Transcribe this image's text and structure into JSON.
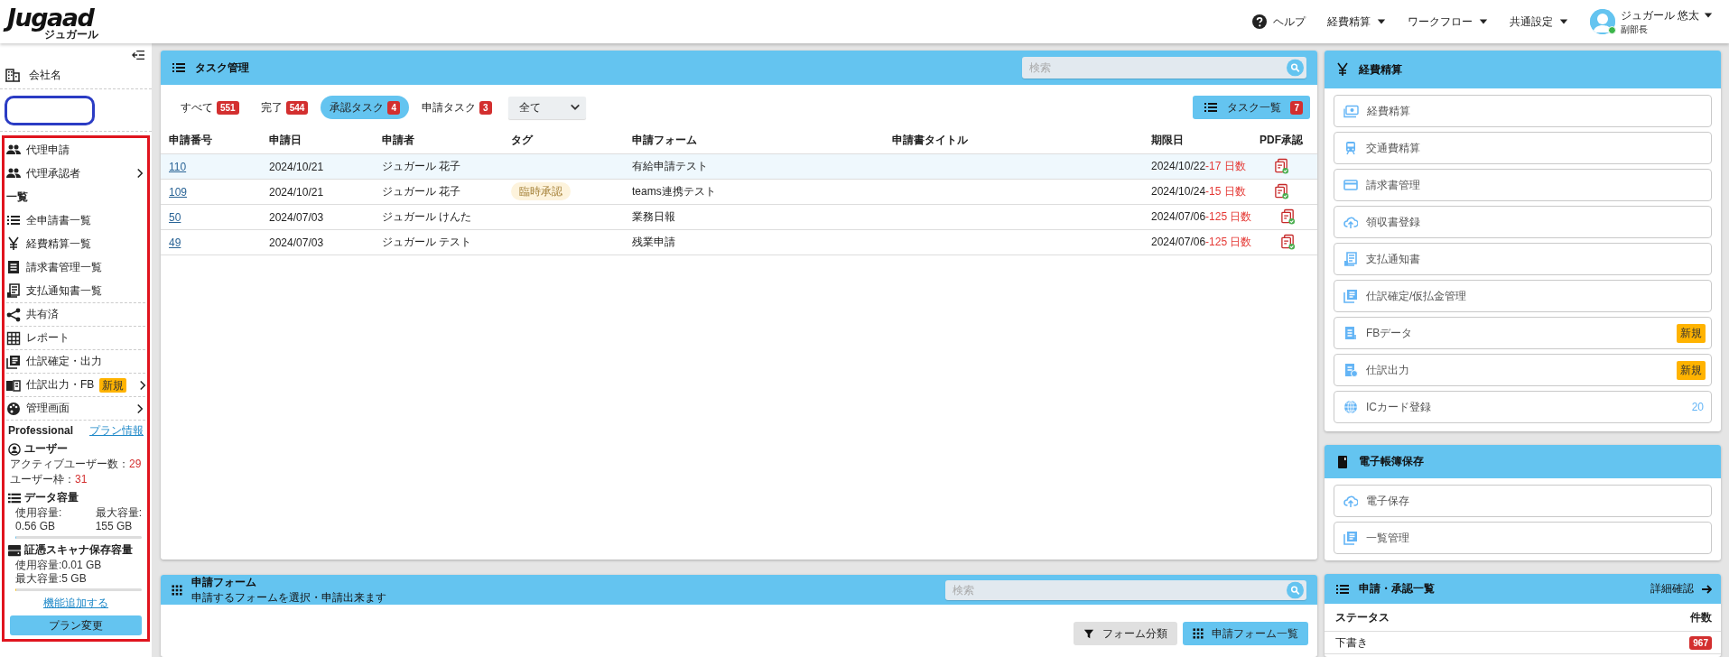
{
  "header": {
    "logo": "Jugaad",
    "logo_sub": "ジュガール",
    "menus": [
      {
        "label": "ヘルプ",
        "kind": "help",
        "has_dropdown": false
      },
      {
        "label": "経費精算",
        "kind": "menu",
        "has_dropdown": true
      },
      {
        "label": "ワークフロー",
        "kind": "menu",
        "has_dropdown": true
      },
      {
        "label": "共通設定",
        "kind": "menu",
        "has_dropdown": true
      }
    ],
    "user": {
      "name": "ジュガール 悠太",
      "role": "副部長",
      "online": true,
      "has_dropdown": true
    }
  },
  "sidebar": {
    "company_label": "会社名",
    "items": [
      {
        "kind": "item",
        "label": "代理申請",
        "has_submenu": false
      },
      {
        "kind": "item",
        "label": "代理承認者",
        "has_submenu": true
      },
      {
        "kind": "heading",
        "label": "一覧"
      },
      {
        "kind": "item",
        "label": "全申請書一覧",
        "has_submenu": false
      },
      {
        "kind": "item",
        "label": "経費精算一覧",
        "has_submenu": false
      },
      {
        "kind": "item",
        "label": "請求書管理一覧",
        "has_submenu": false
      },
      {
        "kind": "item",
        "label": "支払通知書一覧",
        "has_submenu": false
      },
      {
        "kind": "item",
        "label": "共有済",
        "has_submenu": false
      },
      {
        "kind": "item",
        "label": "レポート",
        "has_submenu": false
      },
      {
        "kind": "item",
        "label": "仕訳確定・出力",
        "has_submenu": false
      },
      {
        "kind": "item",
        "label": "仕訳出力・FB",
        "badge": "新規",
        "has_submenu": true
      },
      {
        "kind": "item",
        "label": "管理画面",
        "has_submenu": true
      }
    ],
    "plan": {
      "name": "Professional",
      "link": "プラン情報",
      "users": {
        "title": "ユーザー",
        "active_label": "アクティブユーザー数：",
        "active_value": "29",
        "limit_label": "ユーザー枠：",
        "limit_value": "31"
      },
      "storage": {
        "title": "データ容量",
        "used_label": "使用容量:",
        "used_value": "0.56 GB",
        "max_label": "最大容量:",
        "max_value": "155 GB",
        "level": 0.01
      },
      "scanner": {
        "title": "証憑スキャナ保存容量",
        "used": "使用容量:0.01 GB",
        "max": "最大容量:5 GB",
        "level": 0.01
      },
      "add_link": "機能追加する",
      "button": "プラン変更"
    }
  },
  "task_panel": {
    "title": "タスク管理",
    "search": {
      "placeholder": "検索"
    },
    "tabs": [
      {
        "label": "すべて",
        "count": "551",
        "selected": false
      },
      {
        "label": "完了",
        "count": "544",
        "selected": false
      },
      {
        "label": "承認タスク",
        "count": "4",
        "selected": true
      },
      {
        "label": "申請タスク",
        "count": "3",
        "selected": false
      }
    ],
    "filter": {
      "value": "全て"
    },
    "list_button": {
      "label": "タスク一覧",
      "count": "7"
    },
    "table": {
      "columns": [
        "申請番号",
        "申請日",
        "申請者",
        "タグ",
        "申請フォーム",
        "申請書タイトル",
        "期限日",
        "PDF承認"
      ],
      "rows": [
        {
          "number": "110",
          "date": "2024/10/21",
          "applicant": "ジュガール 花子",
          "form": "有給申請テスト",
          "due": "2024/10/22",
          "overdue": "-17 日数",
          "selected": true
        },
        {
          "number": "109",
          "date": "2024/10/21",
          "applicant": "ジュガール 花子",
          "tag": "臨時承認",
          "form": "teams連携テスト",
          "due": "2024/10/24",
          "overdue": "-15 日数",
          "selected": false
        },
        {
          "number": "50",
          "date": "2024/07/03",
          "applicant": "ジュガール けんた",
          "form": "業務日報",
          "due": "2024/07/06",
          "overdue": "-125 日数",
          "selected": false
        },
        {
          "number": "49",
          "date": "2024/07/03",
          "applicant": "ジュガール テスト",
          "form": "残業申請",
          "due": "2024/07/06",
          "overdue": "-125 日数",
          "selected": false
        }
      ]
    }
  },
  "form_panel": {
    "title": "申請フォーム",
    "subtitle": "申請するフォームを選択・申請出来ます",
    "search": {
      "placeholder": "検索"
    },
    "buttons": [
      {
        "label": "フォーム分類",
        "kind": "secondary"
      },
      {
        "label": "申請フォーム一覧",
        "kind": "primary"
      }
    ]
  },
  "expense_panel": {
    "title": "経費精算",
    "items": [
      {
        "label": "経費精算"
      },
      {
        "label": "交通費精算"
      },
      {
        "label": "請求書管理"
      },
      {
        "label": "領収書登録"
      },
      {
        "label": "支払通知書"
      },
      {
        "label": "仕訳確定/仮払金管理"
      },
      {
        "label": "FBデータ",
        "badge": "新規"
      },
      {
        "label": "仕訳出力",
        "badge": "新規"
      },
      {
        "label": "ICカード登録",
        "count": "20"
      }
    ]
  },
  "ebook_panel": {
    "title": "電子帳簿保存",
    "items": [
      {
        "label": "電子保存"
      },
      {
        "label": "一覧管理"
      }
    ]
  },
  "approval_panel": {
    "title": "申請・承認一覧",
    "link": "詳細確認",
    "columns": [
      "ステータス",
      "件数"
    ],
    "rows": [
      {
        "status": "下書き",
        "count": "967"
      }
    ]
  }
}
